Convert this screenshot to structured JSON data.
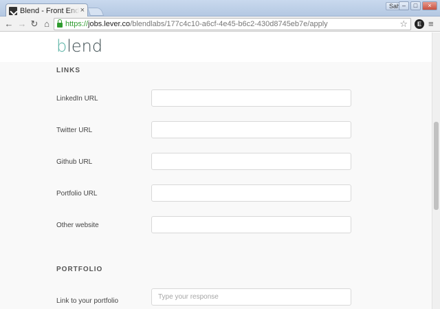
{
  "browser": {
    "tab_title": "Blend - Front End En",
    "tab_close": "×",
    "user_name": "Sahil",
    "url_scheme": "https://",
    "url_host": "jobs.lever.co",
    "url_path": "/blendlabs/177c4c10-a6cf-4e45-b6c2-430d8745eb7e/apply",
    "extension_letter": "E"
  },
  "logo": {
    "first_letter": "b",
    "rest": "lend"
  },
  "links_section": {
    "heading": "LINKS",
    "fields": [
      {
        "label": "LinkedIn URL",
        "value": "",
        "placeholder": ""
      },
      {
        "label": "Twitter URL",
        "value": "",
        "placeholder": ""
      },
      {
        "label": "Github URL",
        "value": "",
        "placeholder": ""
      },
      {
        "label": "Portfolio URL",
        "value": "",
        "placeholder": ""
      },
      {
        "label": "Other website",
        "value": "",
        "placeholder": ""
      }
    ]
  },
  "portfolio_section": {
    "heading": "PORTFOLIO",
    "fields": [
      {
        "label": "Link to your portfolio",
        "value": "",
        "placeholder": "Type your response"
      }
    ]
  },
  "icons": {
    "back": "←",
    "forward": "→",
    "reload": "↻",
    "home": "⌂",
    "star": "☆",
    "menu": "≡"
  },
  "window_buttons": {
    "minimize": "–",
    "maximize": "□",
    "close": "×"
  }
}
